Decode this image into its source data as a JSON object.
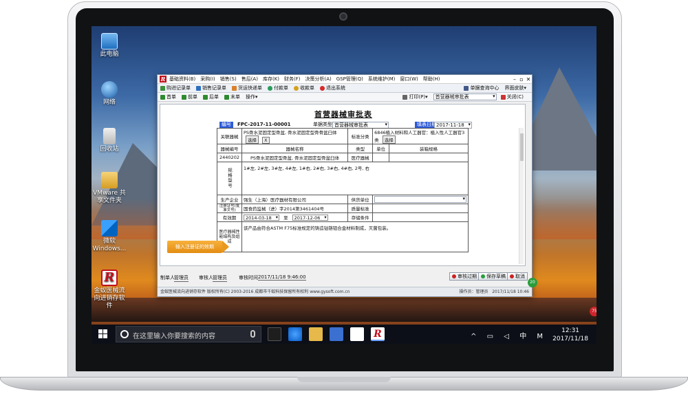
{
  "desktop": {
    "icons": [
      {
        "label": "此电脑"
      },
      {
        "label": "网络"
      },
      {
        "label": "回收站"
      },
      {
        "label": "VMware 共享文件夹"
      },
      {
        "label": "微软Windows..."
      },
      {
        "label": "金蚁医械流向进销存软件"
      }
    ]
  },
  "app": {
    "menu": [
      "基础资料(B)",
      "采购(I)",
      "销售(S)",
      "售后(A)",
      "库存(K)",
      "财务(F)",
      "决策分析(A)",
      "GSP管理(Q)",
      "系统维护(M)",
      "窗口(W)",
      "帮助(H)"
    ],
    "toolbar1": {
      "items": [
        "购进记录单",
        "销售记录单",
        "货运快递单",
        "付款单",
        "收款单",
        "退出系统"
      ],
      "right": [
        "单据查询中心",
        "界面皮肤"
      ]
    },
    "toolbar2": {
      "nav": [
        "首单",
        "前单",
        "后单",
        "末单",
        "操作"
      ],
      "print": "打印(P)",
      "doc_type": "首营器械审批表",
      "close": "关闭(C)"
    },
    "doc": {
      "title": "首营器械审批表",
      "no_label": "编号",
      "no_value": "FPC-2017-11-00001",
      "type_label": "单据类型",
      "type_value": "首营器械审批表",
      "date_label": "填表日期",
      "date_value": "2017-11-18",
      "related_label": "关联器械",
      "related_value": "PS骨水泥固定型骨盆, 骨水泥固定型骨骨盆臼体",
      "select_btn": "选择",
      "x_btn": "X",
      "std_label": "标准分类",
      "std_value": "6846植入材料和人工器官：植入性人工器官3类",
      "col_code": "器械编号",
      "col_name": "器械名称",
      "col_type": "类型",
      "col_unit": "单位",
      "col_spec": "装箱规格",
      "row_code": "2440202",
      "row_name": "PS骨水泥固定型骨盆, 骨水泥固定型骨盆臼体",
      "row_type": "医疗器械",
      "spec_label": "规格型号",
      "spec_value": "1#左, 2#左, 3#左, 4#左, 1#右, 2#右, 3#右, 4#右, 2号, 右",
      "maker_label": "生产企业",
      "maker_value": "强生（上海）医疗器材有限公司",
      "supplier_label": "供货单位",
      "reg_label": "注册证号(批准文号)",
      "reg_value": "国食药监械（进）字2014第3461404号",
      "quality_label": "质量标准",
      "valid_label": "有效期",
      "valid_from": "2014-03-18",
      "valid_to_label": "至",
      "valid_to": "2017-12-06",
      "storage_label": "存储条件",
      "perf_label": "医疗器械性能结构及组成",
      "perf_value": "该产品由符合ASTM F75标准规定的铸造钴铬钼合金材料制成，灭菌包装。"
    },
    "callout": "输入注册证的效期",
    "footer": {
      "maker_label": "制单人",
      "maker_value": "管理员",
      "auditor_label": "审核人",
      "auditor_value": "管理员",
      "audit_time_label": "审核时间",
      "audit_time_value": "2017/11/18 9:46:00",
      "btn_fail": "审核过期",
      "btn_save": "保存草稿",
      "btn_cancel": "取消"
    },
    "status": {
      "left": "金蚁医械流向进销存软件 版权所有(C) 2003-2016 成都市千蚁科技保留所有权利 www.gysoft.com.cn",
      "operator": "操作员：管理员",
      "time": "2017/11/18 10:46"
    }
  },
  "taskbar": {
    "search_placeholder": "在这里输入你要搜索的内容",
    "sys_tray": "^ 中 M",
    "ime": "中",
    "clock_time": "12:31",
    "clock_date": "2017/11/18"
  },
  "edge_badges": [
    "20",
    "75"
  ]
}
